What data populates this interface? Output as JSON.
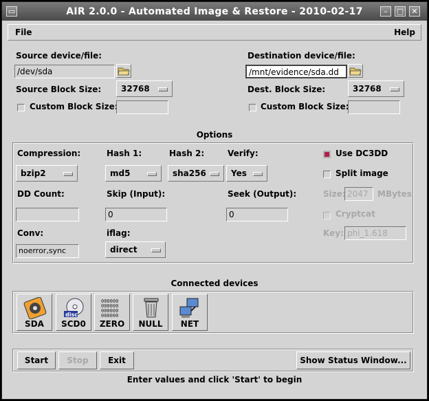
{
  "window": {
    "title": "AIR 2.0.0 - Automated Image & Restore - 2010-02-17"
  },
  "menu": {
    "file": "File",
    "help": "Help"
  },
  "source": {
    "label": "Source device/file:",
    "value": "/dev/sda",
    "block_size_label": "Source Block Size:",
    "block_size": "32768",
    "custom_label": "Custom Block Size:",
    "custom_value": ""
  },
  "destination": {
    "label": "Destination device/file:",
    "value": "/mnt/evidence/sda.dd",
    "block_size_label": "Dest. Block Size:",
    "block_size": "32768",
    "custom_label": "Custom Block Size:",
    "custom_value": ""
  },
  "options": {
    "title": "Options",
    "compression_label": "Compression:",
    "compression": "bzip2",
    "hash1_label": "Hash 1:",
    "hash1": "md5",
    "hash2_label": "Hash 2:",
    "hash2": "sha256",
    "verify_label": "Verify:",
    "verify": "Yes",
    "use_dc3dd_label": "Use DC3DD",
    "use_dc3dd": true,
    "split_image_label": "Split image",
    "split_image": false,
    "size_label": "Size:",
    "size_value": "2047",
    "size_unit": "MBytes",
    "cryptcat_label": "Cryptcat",
    "cryptcat": false,
    "key_label": "Key:",
    "key_value": "phi_1.618",
    "dd_count_label": "DD Count:",
    "dd_count": "",
    "skip_label": "Skip (Input):",
    "skip": "0",
    "seek_label": "Seek (Output):",
    "seek": "0",
    "conv_label": "Conv:",
    "conv": "noerror,sync",
    "iflag_label": "iflag:",
    "iflag": "direct"
  },
  "devices": {
    "title": "Connected devices",
    "items": [
      {
        "label": "SDA",
        "icon": "hard-disk-icon"
      },
      {
        "label": "SCD0",
        "icon": "cd-disc-icon"
      },
      {
        "label": "ZERO",
        "icon": "zeros-icon"
      },
      {
        "label": "NULL",
        "icon": "trash-icon"
      },
      {
        "label": "NET",
        "icon": "network-icon"
      }
    ]
  },
  "actions": {
    "start": "Start",
    "stop": "Stop",
    "exit": "Exit",
    "status_window": "Show Status Window..."
  },
  "status": "Enter values and click 'Start' to begin",
  "colors": {
    "checked": "#b0204a",
    "background": "#d4d4d4"
  }
}
